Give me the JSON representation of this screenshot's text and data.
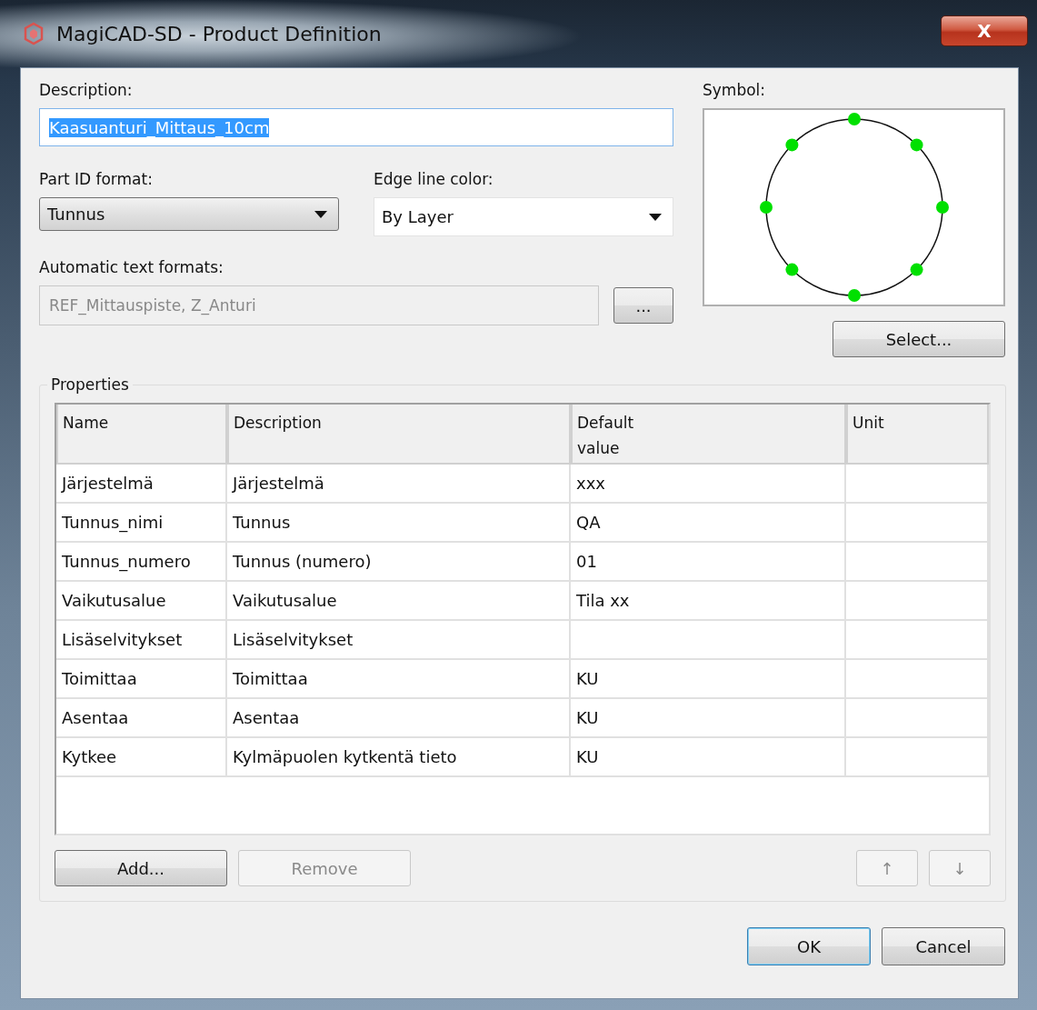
{
  "window": {
    "title": "MagiCAD-SD - Product Definition",
    "close": "X"
  },
  "description": {
    "label": "Description:",
    "value": "Kaasuanturi_Mittaus_10cm",
    "text_selected": true
  },
  "part_id_format": {
    "label": "Part ID format:",
    "value": "Tunnus"
  },
  "edge_line_color": {
    "label": "Edge line color:",
    "value": "By Layer"
  },
  "automatic_text_formats": {
    "label": "Automatic text formats:",
    "value": "REF_Mittauspiste, Z_Anturi",
    "disabled": true,
    "button": "..."
  },
  "symbol": {
    "label": "Symbol:",
    "button": "Select..."
  },
  "properties": {
    "title": "Properties",
    "columns": [
      "Name",
      "Description",
      "Default\nvalue",
      "Unit"
    ],
    "rows": [
      {
        "name": "Järjestelmä",
        "description": "Järjestelmä",
        "default_value": "xxx"
      },
      {
        "name": "Tunnus_nimi",
        "description": "Tunnus",
        "default_value": "QA"
      },
      {
        "name": "Tunnus_numero",
        "description": "Tunnus (numero)",
        "default_value": "01"
      },
      {
        "name": "Vaikutusalue",
        "description": "Vaikutusalue",
        "default_value": "Tila xx"
      },
      {
        "name": "Lisäselvitykset",
        "description": "Lisäselvitykset"
      },
      {
        "name": "Toimittaa",
        "description": "Toimittaa",
        "default_value": "KU"
      },
      {
        "name": "Asentaa",
        "description": "Asentaa",
        "default_value": "KU"
      },
      {
        "name": "Kytkee",
        "description": "Kylmäpuolen kytkentä tieto",
        "default_value": "KU"
      }
    ],
    "buttons": [
      {
        "label": "Add...",
        "disabled": false
      },
      {
        "label": "Remove",
        "disabled": true
      }
    ],
    "move_buttons": [
      {
        "label": "↑",
        "disabled": true
      },
      {
        "label": "↓",
        "disabled": true
      }
    ]
  },
  "footer_buttons": [
    {
      "label": "OK",
      "default": true
    },
    {
      "label": "Cancel",
      "default": false
    }
  ]
}
